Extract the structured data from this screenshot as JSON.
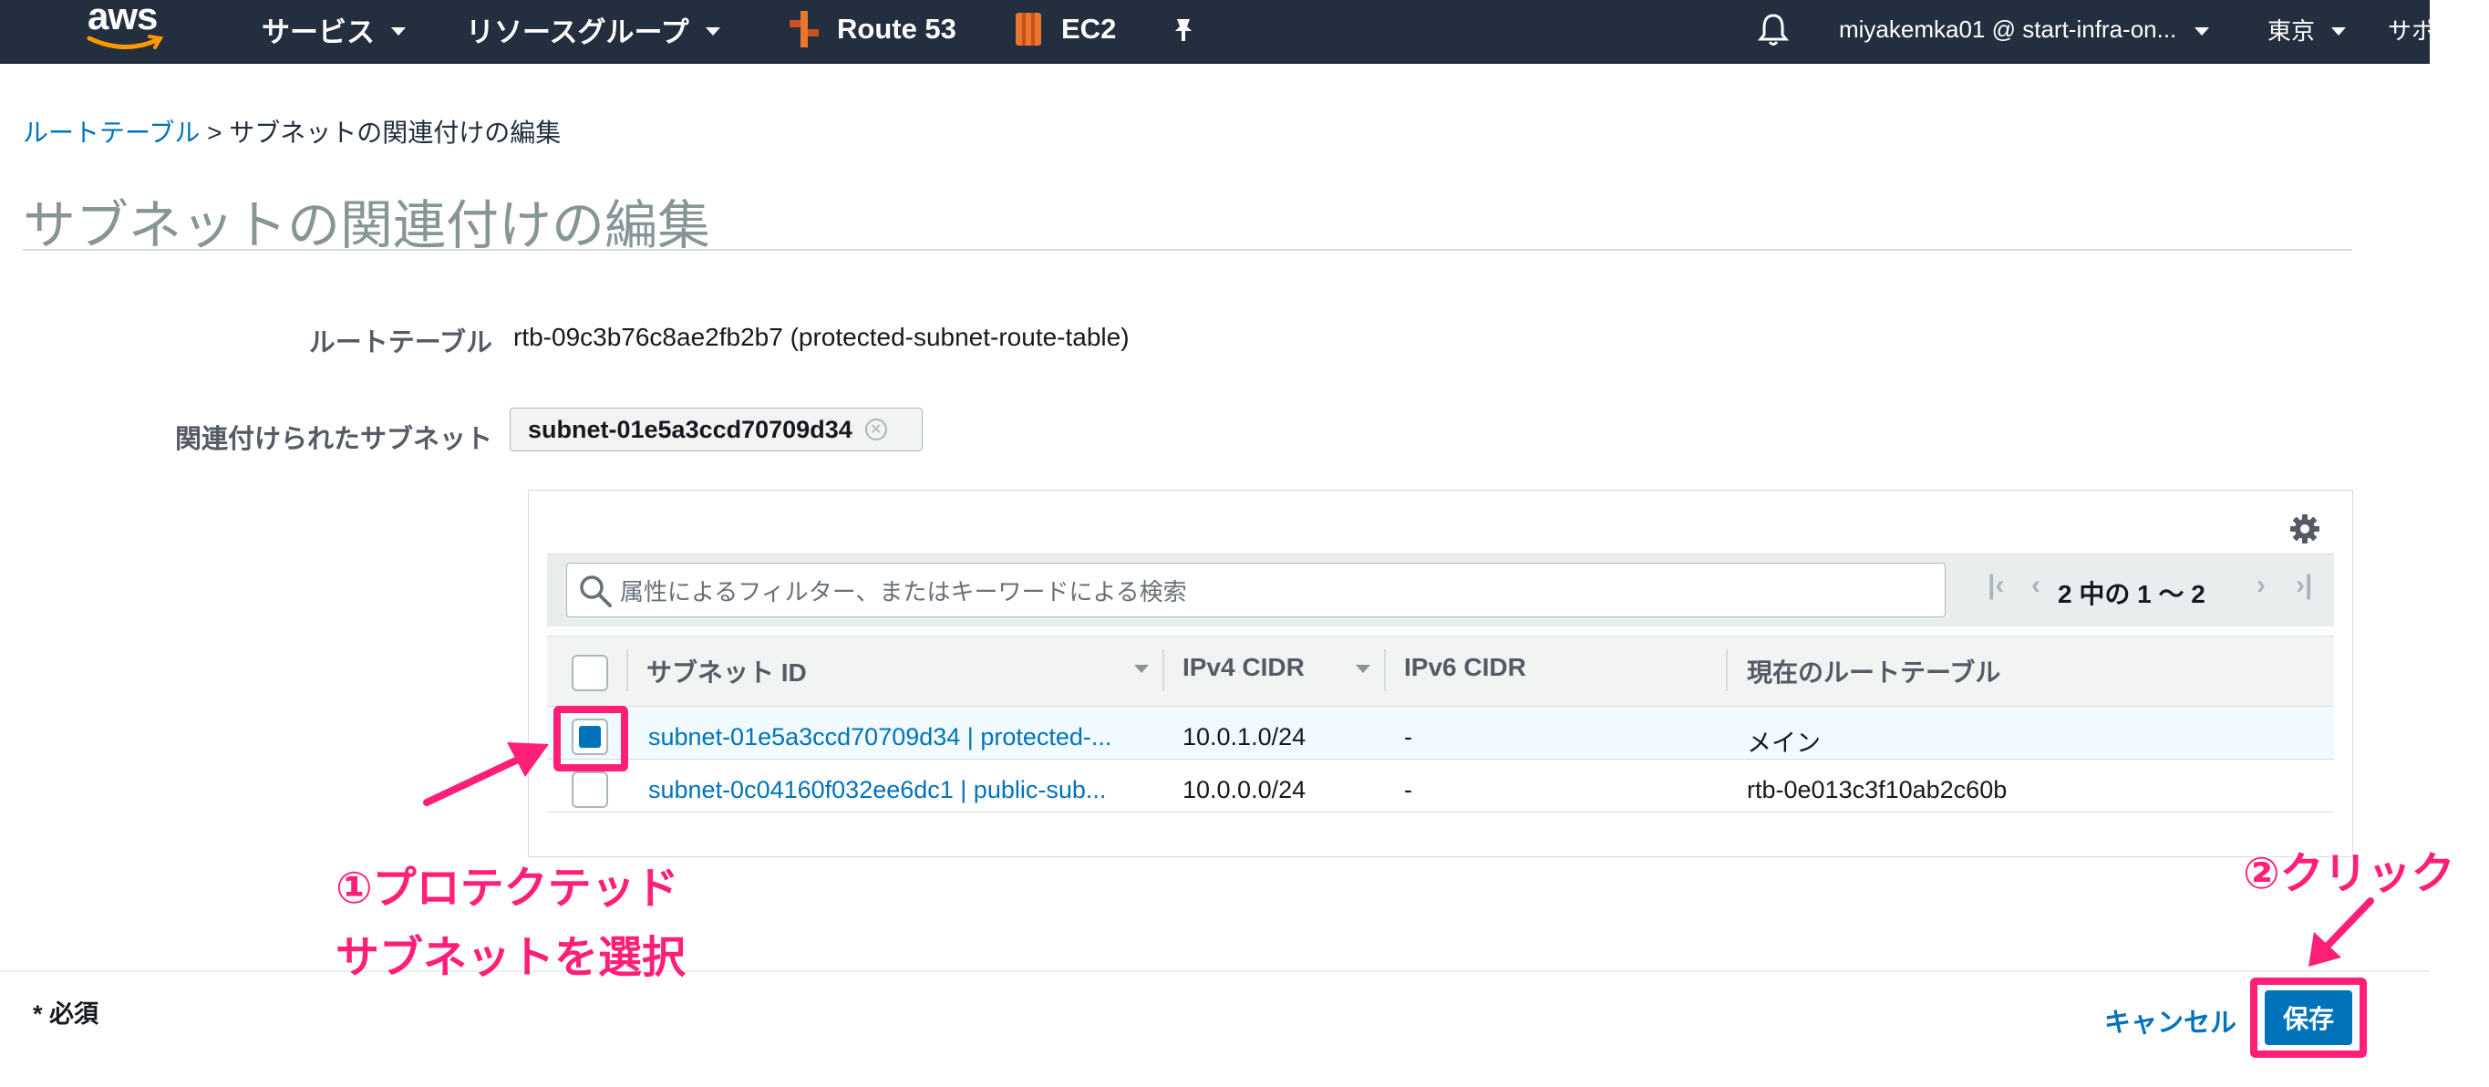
{
  "nav": {
    "logo": "aws",
    "services": "サービス",
    "resource_groups": "リソースグループ",
    "pin1": "Route 53",
    "pin2": "EC2",
    "account": "miyakemka01 @ start-infra-on...",
    "region": "東京",
    "support": "サポ"
  },
  "breadcrumb": {
    "link": "ルートテーブル",
    "separator": ">",
    "current": "サブネットの関連付けの編集"
  },
  "page_title": "サブネットの関連付けの編集",
  "form": {
    "route_table_label": "ルートテーブル",
    "route_table_value": "rtb-09c3b76c8ae2fb2b7 (protected-subnet-route-table)",
    "associated_label": "関連付けられたサブネット",
    "associated_token": "subnet-01e5a3ccd70709d34"
  },
  "table": {
    "search_placeholder": "属性によるフィルター、またはキーワードによる検索",
    "pagination": "2 中の 1 ～ 2",
    "headers": {
      "subnet_id": "サブネット ID",
      "ipv4": "IPv4 CIDR",
      "ipv6": "IPv6 CIDR",
      "current_rt": "現在のルートテーブル"
    },
    "rows": [
      {
        "subnet": "subnet-01e5a3ccd70709d34 | protected-...",
        "ipv4": "10.0.1.0/24",
        "ipv6": "-",
        "rt": "メイン",
        "selected": true
      },
      {
        "subnet": "subnet-0c04160f032ee6dc1 | public-sub...",
        "ipv4": "10.0.0.0/24",
        "ipv6": "-",
        "rt": "rtb-0e013c3f10ab2c60b",
        "selected": false
      }
    ]
  },
  "footer": {
    "required": "* 必須",
    "cancel": "キャンセル",
    "save": "保存"
  },
  "annotations": {
    "step1_line1": "①プロテクテッド",
    "step1_line2": "サブネットを選択",
    "step2": "②クリック"
  },
  "colors": {
    "nav_bg": "#232f3e",
    "accent": "#0073bb",
    "highlight": "#ff1f78"
  }
}
